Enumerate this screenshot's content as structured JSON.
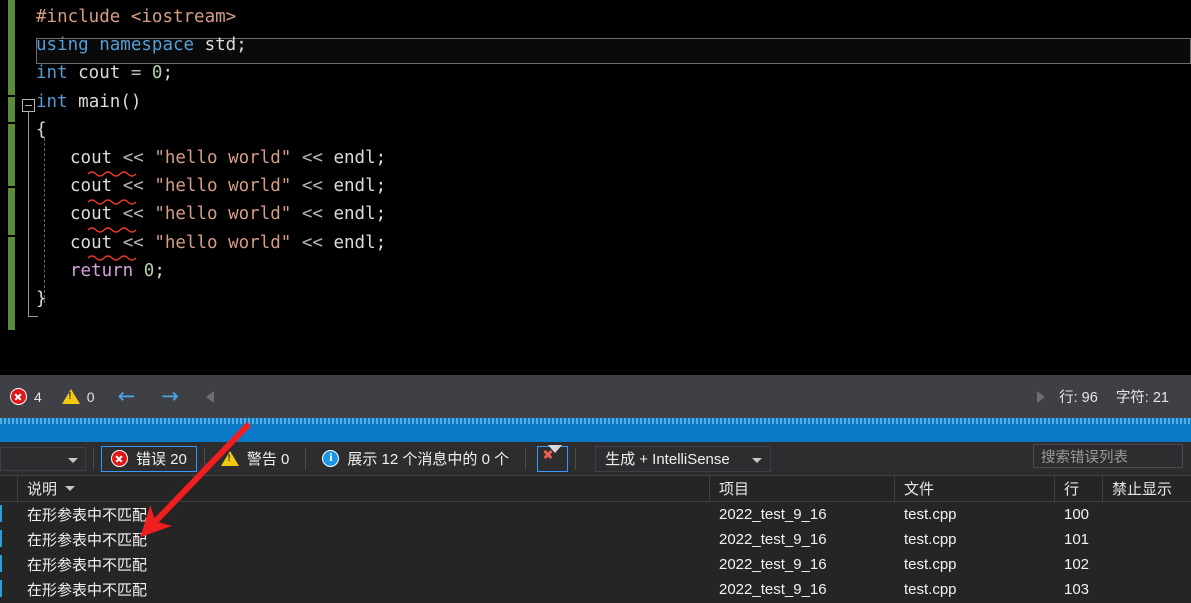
{
  "editor": {
    "lines": [
      {
        "indent": 0,
        "tokens": [
          {
            "t": "#include",
            "c": "pre"
          },
          {
            "t": " ",
            "c": "plain"
          },
          {
            "t": "<iostream>",
            "c": "str"
          }
        ]
      },
      {
        "indent": 0,
        "tokens": [
          {
            "t": "using",
            "c": "blue"
          },
          {
            "t": " ",
            "c": "plain"
          },
          {
            "t": "namespace",
            "c": "blue"
          },
          {
            "t": " std;",
            "c": "plain"
          }
        ]
      },
      {
        "indent": 0,
        "tokens": [
          {
            "t": "int",
            "c": "blue"
          },
          {
            "t": " cout ",
            "c": "plain"
          },
          {
            "t": "=",
            "c": "op"
          },
          {
            "t": " ",
            "c": "plain"
          },
          {
            "t": "0",
            "c": "num"
          },
          {
            "t": ";",
            "c": "plain"
          }
        ]
      },
      {
        "indent": 0,
        "tokens": [
          {
            "t": "int",
            "c": "blue"
          },
          {
            "t": " ",
            "c": "plain"
          },
          {
            "t": "main",
            "c": "id"
          },
          {
            "t": "()",
            "c": "plain"
          }
        ]
      },
      {
        "indent": 0,
        "tokens": [
          {
            "t": "{",
            "c": "plain"
          }
        ]
      },
      {
        "indent": 1,
        "tokens": [
          {
            "t": "cout",
            "c": "plain"
          },
          {
            "t": " ",
            "c": "plain"
          },
          {
            "t": "<<",
            "c": "op"
          },
          {
            "t": " ",
            "c": "plain"
          },
          {
            "t": "\"hello world\"",
            "c": "str"
          },
          {
            "t": " ",
            "c": "plain"
          },
          {
            "t": "<<",
            "c": "op"
          },
          {
            "t": " ",
            "c": "plain"
          },
          {
            "t": "endl",
            "c": "plain"
          },
          {
            "t": ";",
            "c": "plain"
          }
        ]
      },
      {
        "indent": 1,
        "tokens": [
          {
            "t": "cout",
            "c": "plain"
          },
          {
            "t": " ",
            "c": "plain"
          },
          {
            "t": "<<",
            "c": "op"
          },
          {
            "t": " ",
            "c": "plain"
          },
          {
            "t": "\"hello world\"",
            "c": "str"
          },
          {
            "t": " ",
            "c": "plain"
          },
          {
            "t": "<<",
            "c": "op"
          },
          {
            "t": " ",
            "c": "plain"
          },
          {
            "t": "endl",
            "c": "plain"
          },
          {
            "t": ";",
            "c": "plain"
          }
        ]
      },
      {
        "indent": 1,
        "tokens": [
          {
            "t": "cout",
            "c": "plain"
          },
          {
            "t": " ",
            "c": "plain"
          },
          {
            "t": "<<",
            "c": "op"
          },
          {
            "t": " ",
            "c": "plain"
          },
          {
            "t": "\"hello world\"",
            "c": "str"
          },
          {
            "t": " ",
            "c": "plain"
          },
          {
            "t": "<<",
            "c": "op"
          },
          {
            "t": " ",
            "c": "plain"
          },
          {
            "t": "endl",
            "c": "plain"
          },
          {
            "t": ";",
            "c": "plain"
          }
        ]
      },
      {
        "indent": 1,
        "tokens": [
          {
            "t": "cout",
            "c": "plain"
          },
          {
            "t": " ",
            "c": "plain"
          },
          {
            "t": "<<",
            "c": "op"
          },
          {
            "t": " ",
            "c": "plain"
          },
          {
            "t": "\"hello world\"",
            "c": "str"
          },
          {
            "t": " ",
            "c": "plain"
          },
          {
            "t": "<<",
            "c": "op"
          },
          {
            "t": " ",
            "c": "plain"
          },
          {
            "t": "endl",
            "c": "plain"
          },
          {
            "t": ";",
            "c": "plain"
          }
        ]
      },
      {
        "indent": 1,
        "tokens": [
          {
            "t": "return",
            "c": "purple"
          },
          {
            "t": " ",
            "c": "plain"
          },
          {
            "t": "0",
            "c": "num"
          },
          {
            "t": ";",
            "c": "plain"
          }
        ]
      },
      {
        "indent": 0,
        "tokens": [
          {
            "t": "}",
            "c": "plain"
          }
        ]
      }
    ],
    "full_text": "#include <iostream>\nusing namespace std;\nint cout = 0;\nint main()\n{\n    cout << \"hello world\" << endl;\n    cout << \"hello world\" << endl;\n    cout << \"hello world\" << endl;\n    cout << \"hello world\" << endl;\n    return 0;\n}"
  },
  "navbar": {
    "error_count": "4",
    "warning_count": "0",
    "back_arrow": "←",
    "forward_arrow": "→",
    "line_label": "行: 96",
    "char_label": "字符: 21"
  },
  "error_list": {
    "toolbar": {
      "scope_combo_value": "",
      "errors_label": "错误 20",
      "warnings_label": "警告 0",
      "messages_label": "展示 12 个消息中的 0 个",
      "clear_filter_title": "",
      "build_combo_value": "生成 + IntelliSense"
    },
    "search": {
      "placeholder": "搜索错误列表",
      "value": ""
    },
    "columns": {
      "icon": "",
      "description": "说明",
      "project": "项目",
      "file": "文件",
      "line": "行",
      "suppression": "禁止显示"
    },
    "rows": [
      {
        "description": "在形参表中不匹配",
        "project": "2022_test_9_16",
        "file": "test.cpp",
        "line": "100",
        "suppression": ""
      },
      {
        "description": "在形参表中不匹配",
        "project": "2022_test_9_16",
        "file": "test.cpp",
        "line": "101",
        "suppression": ""
      },
      {
        "description": "在形参表中不匹配",
        "project": "2022_test_9_16",
        "file": "test.cpp",
        "line": "102",
        "suppression": ""
      },
      {
        "description": "在形参表中不匹配",
        "project": "2022_test_9_16",
        "file": "test.cpp",
        "line": "103",
        "suppression": ""
      }
    ]
  },
  "colors": {
    "editor_bg": "#000000",
    "panel_bg": "#252526",
    "toolbar_bg": "#2d2d30",
    "navbar_bg": "#3f3f46",
    "dock_highlight": "#0a7ac8",
    "accent_blue": "#3399ff",
    "error_red": "#e11717",
    "warning_yellow": "#f2c811",
    "info_blue": "#1c97e8",
    "change_bar_green": "#5a8a3c",
    "annotation_red": "#f01e1e"
  }
}
